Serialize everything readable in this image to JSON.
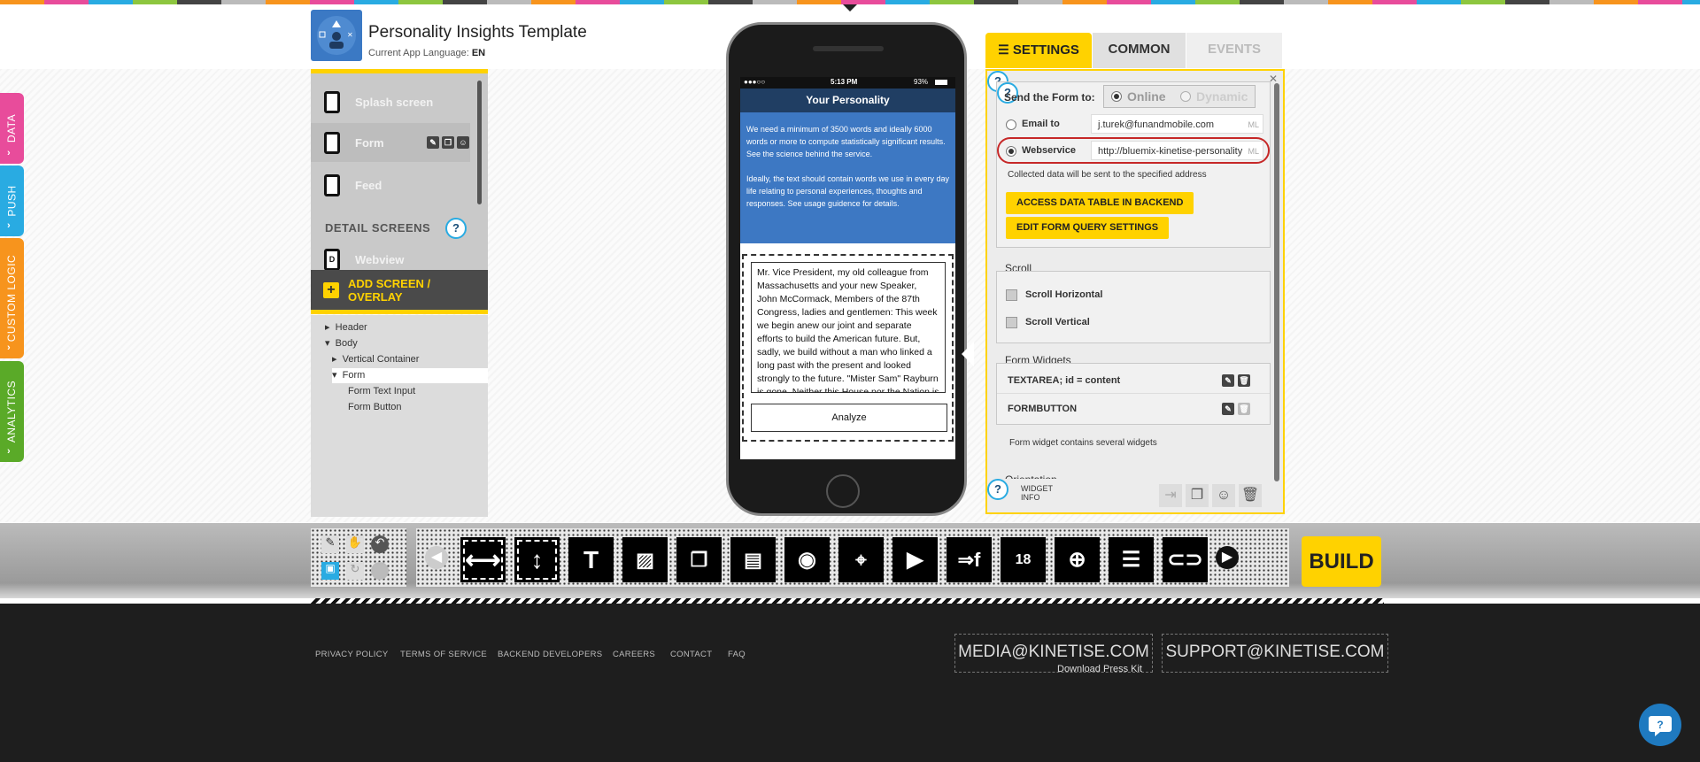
{
  "side_tabs": [
    {
      "label": "DATA",
      "color": "#e84c9b"
    },
    {
      "label": "PUSH",
      "color": "#29abe2"
    },
    {
      "label": "CUSTOM LOGIC",
      "color": "#f7941d"
    },
    {
      "label": "ANALYTICS",
      "color": "#5aaa28"
    }
  ],
  "app": {
    "title": "Personality Insights Template",
    "language_label": "Current App Language:",
    "language": "EN"
  },
  "screens": {
    "items": [
      {
        "label": "Splash screen"
      },
      {
        "label": "Form"
      },
      {
        "label": "Feed"
      }
    ],
    "detail_header": "DETAIL SCREENS",
    "detail_items": [
      {
        "label": "Webview",
        "badge": "D"
      }
    ],
    "add_label": "ADD SCREEN / OVERLAY"
  },
  "tree": [
    "Header",
    "Body",
    "Vertical Container",
    "Form",
    "Form Text Input",
    "Form Button"
  ],
  "phone": {
    "time": "5:13 PM",
    "battery": "93%",
    "nav_title": "Your Personality",
    "intro_1": "We need a minimum of 3500 words and ideally 6000 words or more to compute statistically significant results. See the science behind the service.",
    "intro_2": "Ideally, the text should contain words we use in every day life relating to personal experiences, thoughts and responses. See usage guidence for details.",
    "textarea": "Mr. Vice President, my old colleague from Massachusetts and your new Speaker, John McCormack, Members of the 87th Congress, ladies and gentlemen:  This week we begin anew our joint and separate efforts to build the American future. But, sadly, we build without a man who linked a long past with the present and looked strongly to the future. \"Mister Sam\" Rayburn is gone. Neither this House nor the Nation is the same without him.",
    "button": "Analyze"
  },
  "settings": {
    "tabs": [
      "SETTINGS",
      "COMMON",
      "EVENTS"
    ],
    "send_label": "Send the Form to:",
    "mode_online": "Online",
    "mode_dynamic": "Dynamic",
    "email_label": "Email to",
    "email_value": "j.turek@funandmobile.com",
    "webservice_label": "Webservice",
    "webservice_value": "http://bluemix-kinetise-personality",
    "ml": "ML",
    "collected_note": "Collected data will be sent to the specified address",
    "btn_access": "ACCESS DATA TABLE IN BACKEND",
    "btn_query": "EDIT FORM QUERY SETTINGS",
    "scroll_header": "Scroll",
    "scroll_h": "Scroll Horizontal",
    "scroll_v": "Scroll Vertical",
    "widgets_header": "Form Widgets",
    "widgets": [
      {
        "label": "TEXTAREA; id = content"
      },
      {
        "label": "FORMBUTTON"
      }
    ],
    "widgets_note": "Form widget contains several widgets",
    "orientation": "Orientation",
    "widget_info": "WIDGET INFO"
  },
  "toolbar": {
    "build": "BUILD",
    "tools": [
      "horizontal-container-icon",
      "vertical-container-icon",
      "text-icon",
      "image-icon",
      "gallery-icon",
      "image-list-icon",
      "video-icon",
      "map-icon",
      "play-icon",
      "facebook-icon",
      "calendar-icon",
      "search-web-icon",
      "list-icon",
      "toggle-icon"
    ],
    "calendar_day": "18"
  },
  "footer": {
    "links": [
      "PRIVACY POLICY",
      "TERMS OF SERVICE",
      "BACKEND DEVELOPERS",
      "CAREERS",
      "CONTACT",
      "FAQ"
    ],
    "media_email": "MEDIA@KINETISE.COM",
    "press_kit": "Download Press Kit",
    "support_email": "SUPPORT@KINETISE.COM"
  },
  "colors": {
    "accent": "#ffd200",
    "blue": "#3d78c3",
    "navy": "#203e63",
    "dark": "#1e1e1e"
  }
}
